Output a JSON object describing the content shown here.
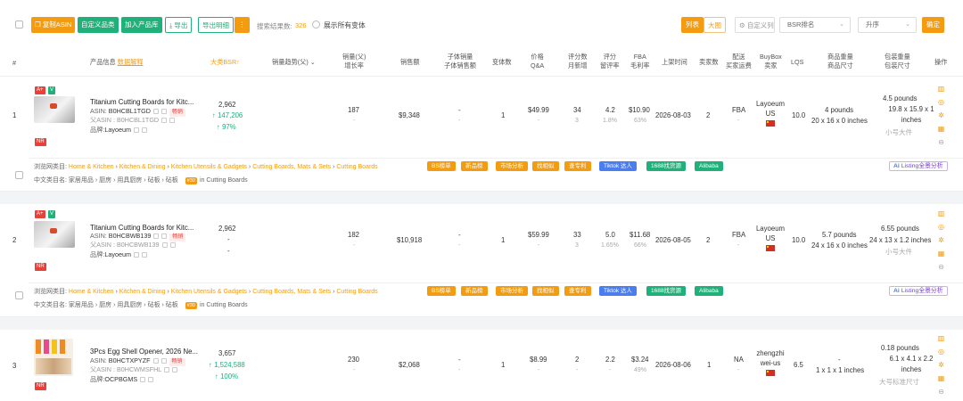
{
  "toolbar": {
    "btn_copy_asin": "复制ASIN",
    "btn_custom_category": "自定义品类",
    "btn_add_library": "加入产品库",
    "btn_export": "导出",
    "btn_export_desc": "导出明细",
    "search_result_label": "搜索结果数:",
    "search_result_count": "326",
    "show_variants_label": "展示所有变体",
    "view_list": "列表",
    "view_grid": "大图",
    "custom_columns": "自定义列",
    "sort_field": "BSR排名",
    "sort_order": "升序",
    "confirm": "确定"
  },
  "columns": {
    "index": "#",
    "product_info": "产品信息",
    "data_explain": "数据解释",
    "bsr": "大类BSR",
    "sales_trend": "销量趋势(父)",
    "sales_parent": "销量(父)",
    "growth": "增长率",
    "revenue": "销售额",
    "child_sales": "子体销量",
    "child_revenue": "子体销售额",
    "variants": "变体数",
    "price": "价格",
    "qa": "Q&A",
    "ratings": "评分数",
    "monthly_new": "月新增",
    "rating": "评分",
    "retention": "留评率",
    "fba": "FBA",
    "margin": "毛利率",
    "launch": "上架时间",
    "sellers": "卖家数",
    "delivery": "配送",
    "buyer_freight": "买家运费",
    "buybox": "BuyBox",
    "buybox_seller": "卖家",
    "lqs": "LQS",
    "product_weight": "商品重量",
    "product_size": "商品尺寸",
    "package_weight": "包装重量",
    "package_size": "包装尺寸",
    "ops": "操作"
  },
  "rows": [
    {
      "index": "1",
      "badge_aplus": "A+",
      "badge_v": "V",
      "badge_nr": "NR",
      "title": "Titanium Cutting Boards for Kitc...",
      "asin_label": "ASIN:",
      "asin": "B0HCBL1TGD",
      "parent_label": "父ASIN :",
      "parent_asin": "B0HCBL1TGD",
      "hot_tag": "畅销",
      "brand_label": "品牌:",
      "brand": "Layoeum",
      "bsr": "2,962",
      "bsr_change": "↑ 147,206",
      "bsr_pct": "↑ 97%",
      "sales": "187",
      "growth": "-",
      "revenue": "$9,348",
      "child_sales": "-",
      "child_revenue": "-",
      "variants": "1",
      "price": "$49.99",
      "qa": "-",
      "ratings": "34",
      "monthly_new": "3",
      "rating": "4.2",
      "retention": "1.8%",
      "fba": "$10.90",
      "margin": "63%",
      "launch": "2026-08-03",
      "sellers": "2",
      "delivery": "FBA",
      "buyer_freight": "-",
      "buybox_seller": "Layoeum US",
      "lqs": "10.0",
      "product_weight": "4 pounds",
      "product_size": "20 x 16 x 0 inches",
      "package_weight": "4.5 pounds",
      "package_size": "19.8 x 15.9 x 1 inches",
      "size_tier": "小号大件",
      "crumb_label": "浏览网类目:",
      "crumbs": [
        "Home & Kitchen",
        "Kitchen & Dining",
        "Kitchen Utensils & Gadgets",
        "Cutting Boards, Mats & Sets",
        "Cutting Boards"
      ],
      "cn_label": "中文类目名:",
      "cn_crumbs": "家居用品 › 厨房 › 用具厨房 › 砧板 › 砧板",
      "rank_pill": "#30",
      "rank_text": "in Cutting Boards",
      "tags": [
        "BS榜单",
        "新品榜",
        "市场分析",
        "找相似",
        "查专利",
        "Tiktok 达人",
        "1688找货源",
        "Alibaba"
      ],
      "ai_btn": "Listing全景分析"
    },
    {
      "index": "2",
      "badge_aplus": "A+",
      "badge_v": "V",
      "badge_nr": "NR",
      "title": "Titanium Cutting Boards for Kitc...",
      "asin_label": "ASIN:",
      "asin": "B0HCBWB139",
      "parent_label": "父ASIN :",
      "parent_asin": "B0HCBWB139",
      "hot_tag": "畅销",
      "brand_label": "品牌:",
      "brand": "Layoeum",
      "bsr": "2,962",
      "bsr_change": "-",
      "bsr_pct": "-",
      "sales": "182",
      "growth": "-",
      "revenue": "$10,918",
      "child_sales": "-",
      "child_revenue": "-",
      "variants": "1",
      "price": "$59.99",
      "qa": "-",
      "ratings": "33",
      "monthly_new": "3",
      "rating": "5.0",
      "retention": "1.65%",
      "fba": "$11.68",
      "margin": "66%",
      "launch": "2026-08-05",
      "sellers": "2",
      "delivery": "FBA",
      "buyer_freight": "-",
      "buybox_seller": "Layoeum US",
      "lqs": "10.0",
      "product_weight": "5.7 pounds",
      "product_size": "24 x 16 x 0 inches",
      "package_weight": "6.55 pounds",
      "package_size": "24 x 13 x 1.2 inches",
      "size_tier": "小号大件",
      "crumb_label": "浏览网类目:",
      "crumbs": [
        "Home & Kitchen",
        "Kitchen & Dining",
        "Kitchen Utensils & Gadgets",
        "Cutting Boards, Mats & Sets",
        "Cutting Boards"
      ],
      "cn_label": "中文类目名:",
      "cn_crumbs": "家居用品 › 厨房 › 用具厨房 › 砧板 › 砧板",
      "rank_pill": "#30",
      "rank_text": "in Cutting Boards",
      "tags": [
        "BS榜单",
        "新品榜",
        "市场分析",
        "找相似",
        "查专利",
        "Tiktok 达人",
        "1688找货源",
        "Alibaba"
      ],
      "ai_btn": "Listing全景分析"
    },
    {
      "index": "3",
      "badge_nr": "NR",
      "title": "3Pcs Egg Shell Opener, 2026 Ne...",
      "asin_label": "ASIN:",
      "asin": "B0HCTXPYZF",
      "parent_label": "父ASIN :",
      "parent_asin": "B0HCWMSFHL",
      "hot_tag": "畅销",
      "brand_label": "品牌:",
      "brand": "OCPBGMS",
      "bsr": "3,657",
      "bsr_change": "↑ 1,524,588",
      "bsr_pct": "↑ 100%",
      "sales": "230",
      "growth": "-",
      "revenue": "$2,068",
      "child_sales": "-",
      "child_revenue": "-",
      "variants": "1",
      "price": "$8.99",
      "qa": "-",
      "ratings": "2",
      "monthly_new": "-",
      "rating": "2.2",
      "retention": "-",
      "fba": "$3.24",
      "margin": "49%",
      "launch": "2026-08-06",
      "sellers": "1",
      "delivery": "NA",
      "buyer_freight": "-",
      "buybox_seller": "zhengzhi wei-us",
      "lqs": "6.5",
      "product_weight": "-",
      "product_size": "1 x 1 x 1 inches",
      "package_weight": "0.18 pounds",
      "package_size": "6.1 x 4.1 x 2.2 inches",
      "size_tier": "大号标准尺寸"
    }
  ]
}
